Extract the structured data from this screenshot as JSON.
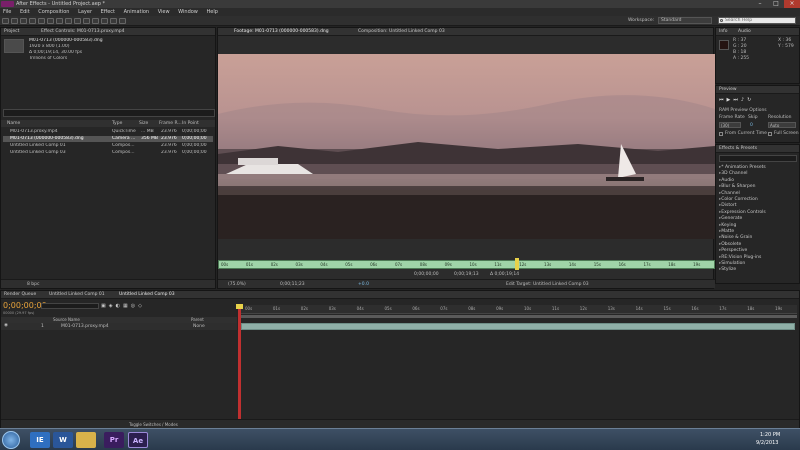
{
  "window": {
    "title": "After Effects - Untitled Project.aep *"
  },
  "menu": [
    "File",
    "Edit",
    "Composition",
    "Layer",
    "Effect",
    "Animation",
    "View",
    "Window",
    "Help"
  ],
  "workspace": {
    "label": "Workspace:",
    "value": "Standard",
    "search_placeholder": "Search Help"
  },
  "project_panel": {
    "tab": "Project",
    "effect_controls_tab": "Effect Controls: M01-0713.proxy.mp4",
    "selected_name": "M01-0713 (000000-000583).dng",
    "info_lines": [
      "1920 x 800 (1.00)",
      "Δ 0;00;19;14, 30.00 fps",
      "Trillions of Colors"
    ],
    "columns": [
      "Name",
      "Type",
      "Size",
      "Frame R...",
      "In Point"
    ],
    "items": [
      {
        "name": "M01-0713.proxy.mp4",
        "type": "QuickTime",
        "size": "... MB",
        "rate": "23.976",
        "in": "0;00;00;00"
      },
      {
        "name": "M01-0713 (000000-000583).dng",
        "type": "Camera ...",
        "size": "356 MB",
        "rate": "23.976",
        "in": "0;00;00;00"
      },
      {
        "name": "Untitled Linked Comp 01",
        "type": "Compos...",
        "size": "",
        "rate": "23.976",
        "in": "0;00;00;00"
      },
      {
        "name": "Untitled Linked Comp 03",
        "type": "Compos...",
        "size": "",
        "rate": "23.976",
        "in": "0;00;00;00"
      }
    ],
    "bpc": "8 bpc"
  },
  "viewer": {
    "footage_tab": "Footage: M01-0713 (000000-000583).dng",
    "comp_tab": "Composition: Untitled Linked Comp 03",
    "ruler": [
      "00s",
      "01s",
      "02s",
      "03s",
      "04s",
      "05s",
      "06s",
      "07s",
      "08s",
      "09s",
      "10s",
      "11s",
      "12s",
      "13s",
      "14s",
      "15s",
      "16s",
      "17s",
      "18s",
      "19s"
    ],
    "time_in": "0;00;00;00",
    "time_out": "0;00;19;13",
    "duration": "Δ 0;00;19;14",
    "zoom": "(75.0%)",
    "current_time": "0;00;11;23",
    "exposure": "+0.0",
    "edit_target": "Edit Target: Untitled Linked Comp 03"
  },
  "info_panel": {
    "tab": "Info",
    "audio_tab": "Audio",
    "r": "R : 37",
    "g": "G : 20",
    "b": "B : 18",
    "a": "A : 255",
    "x": "X : 36",
    "y": "Y : 579"
  },
  "preview_panel": {
    "tab": "Preview",
    "ram_options": "RAM Preview Options",
    "frame_rate_label": "Frame Rate",
    "skip_label": "Skip",
    "resolution_label": "Resolution",
    "frame_rate": "(30)",
    "skip": "0",
    "resolution": "Auto",
    "from_current": "From Current Time",
    "full_screen": "Full Screen"
  },
  "effects_panel": {
    "tab": "Effects & Presets",
    "categories": [
      "* Animation Presets",
      "3D Channel",
      "Audio",
      "Blur & Sharpen",
      "Channel",
      "Color Correction",
      "Distort",
      "Expression Controls",
      "Generate",
      "Keying",
      "Matte",
      "Noise & Grain",
      "Obsolete",
      "Perspective",
      "RE:Vision Plug-ins",
      "Simulation",
      "Stylize"
    ]
  },
  "timeline": {
    "tabs": [
      "Render Queue",
      "Untitled Linked Comp 01",
      "Untitled Linked Comp 03"
    ],
    "timecode": "0;00;00;00",
    "frames": "00000 (29.97 fps)",
    "ruler": [
      "00s",
      "01s",
      "02s",
      "03s",
      "04s",
      "05s",
      "06s",
      "07s",
      "08s",
      "09s",
      "10s",
      "11s",
      "12s",
      "13s",
      "14s",
      "15s",
      "16s",
      "17s",
      "18s",
      "19s"
    ],
    "columns": [
      "Source Name",
      "Parent"
    ],
    "layer": {
      "index": "1",
      "name": "M01-0713.proxy.mp4",
      "parent": "None"
    },
    "toggle_label": "Toggle Switches / Modes"
  },
  "taskbar": {
    "apps": [
      "IE",
      "W",
      "",
      "Pr",
      "Ae"
    ],
    "time": "1:20 PM",
    "date": "9/2/2013"
  }
}
